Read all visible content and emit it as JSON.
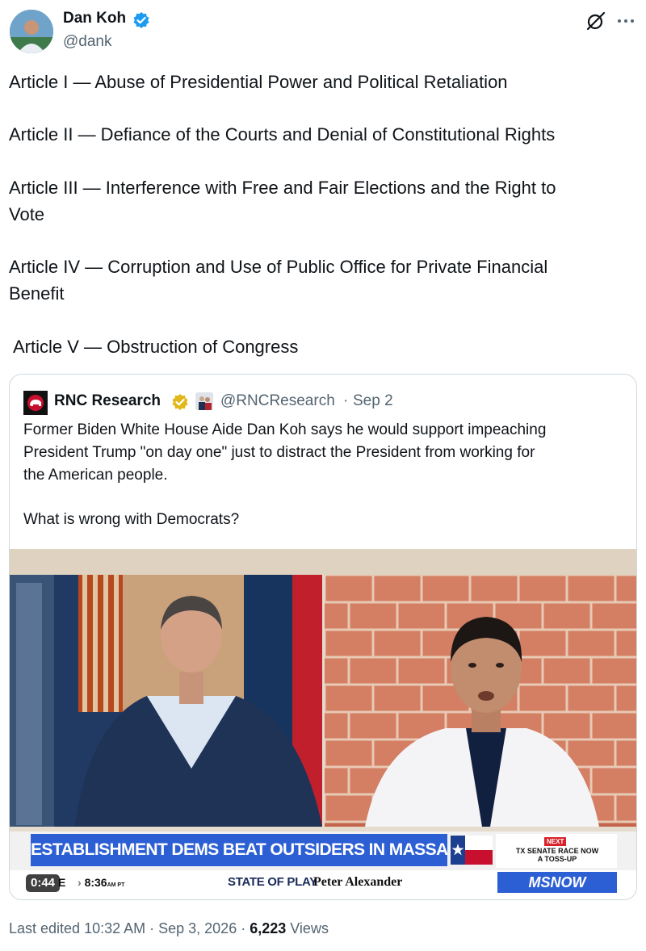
{
  "author": {
    "name": "Dan Koh",
    "handle": "@dank"
  },
  "post": {
    "lines": [
      "Article I — Abuse of Presidential Power and Political Retaliation",
      "Article II — Defiance of the Courts and Denial of Constitutional Rights",
      "Article III — Interference with Free and Fair Elections and the Right to",
      "Vote",
      "Article IV — Corruption and Use of Public Office for Private Financial",
      "Benefit",
      "Article V — Obstruction of Congress"
    ]
  },
  "quote": {
    "name": "RNC Research",
    "handle": "@RNCResearch",
    "separator": "·",
    "date": "Sep 2",
    "text_lines": [
      "Former Biden White House Aide Dan Koh says he would support impeaching",
      "President Trump \"on day one\" just to distract the President from working for",
      "the American people.",
      "What is wrong with Democrats?"
    ],
    "video": {
      "headline": "ESTABLISHMENT DEMS BEAT OUTSIDERS IN MASSACHUSETTS RACES",
      "next_label": "NEXT",
      "next_text_1": "TX SENATE RACE NOW",
      "next_text_2": "A TOSS-UP",
      "live": "E",
      "time": "8:36",
      "time_suffix": "AM PT",
      "show": "STATE OF PLAY",
      "anchor": "Peter Alexander",
      "network": "MSNOW",
      "duration": "0:44"
    }
  },
  "footer": {
    "edited": "Last edited 10:32 AM · Sep 3, 2026 · ",
    "views_count": "6,223",
    "views_label": " Views"
  },
  "colors": {
    "verified_blue": "#1d9bf0",
    "gold_badge": "#e2b719",
    "text_primary": "#0f1419",
    "text_secondary": "#536471",
    "chyron_blue": "#2d5fd4"
  }
}
